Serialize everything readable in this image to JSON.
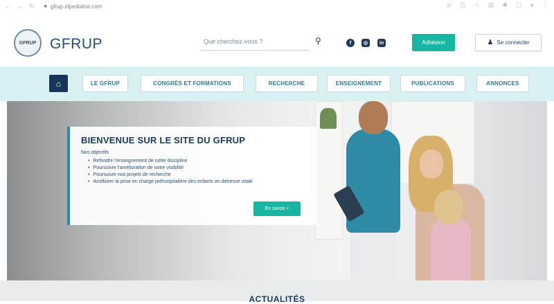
{
  "browser": {
    "url": "gfrup.sfpediatrie.com"
  },
  "header": {
    "logo_text": "GFRUP",
    "brand": "GFRUP",
    "search_placeholder": "Que cherchez-vous ?",
    "join_label": "Adhésion",
    "login_label": "Se connecter"
  },
  "nav": {
    "items": [
      "LE GFRUP",
      "CONGRÈS ET FORMATIONS",
      "RECHERCHE",
      "ENSEIGNEMENT",
      "PUBLICATIONS",
      "ANNONCES"
    ]
  },
  "hero": {
    "title": "BIENVENUE SUR LE SITE DU GFRUP",
    "intro": "Nos objectifs",
    "objectives": [
      "Refondre l'enseignement de notre discipline",
      "Poursuivre l'amélioration de notre visibilité",
      "Poursuivre nos projets de recherche",
      "Améliorer la prise en charge préhospitalière des enfants en détresse vitale"
    ],
    "cta_label": "En savoir +"
  },
  "news": {
    "title": "ACTUALITÉS"
  },
  "colors": {
    "accent": "#17b6a2",
    "navy": "#17355b",
    "nav_band": "#d9f1f3"
  }
}
